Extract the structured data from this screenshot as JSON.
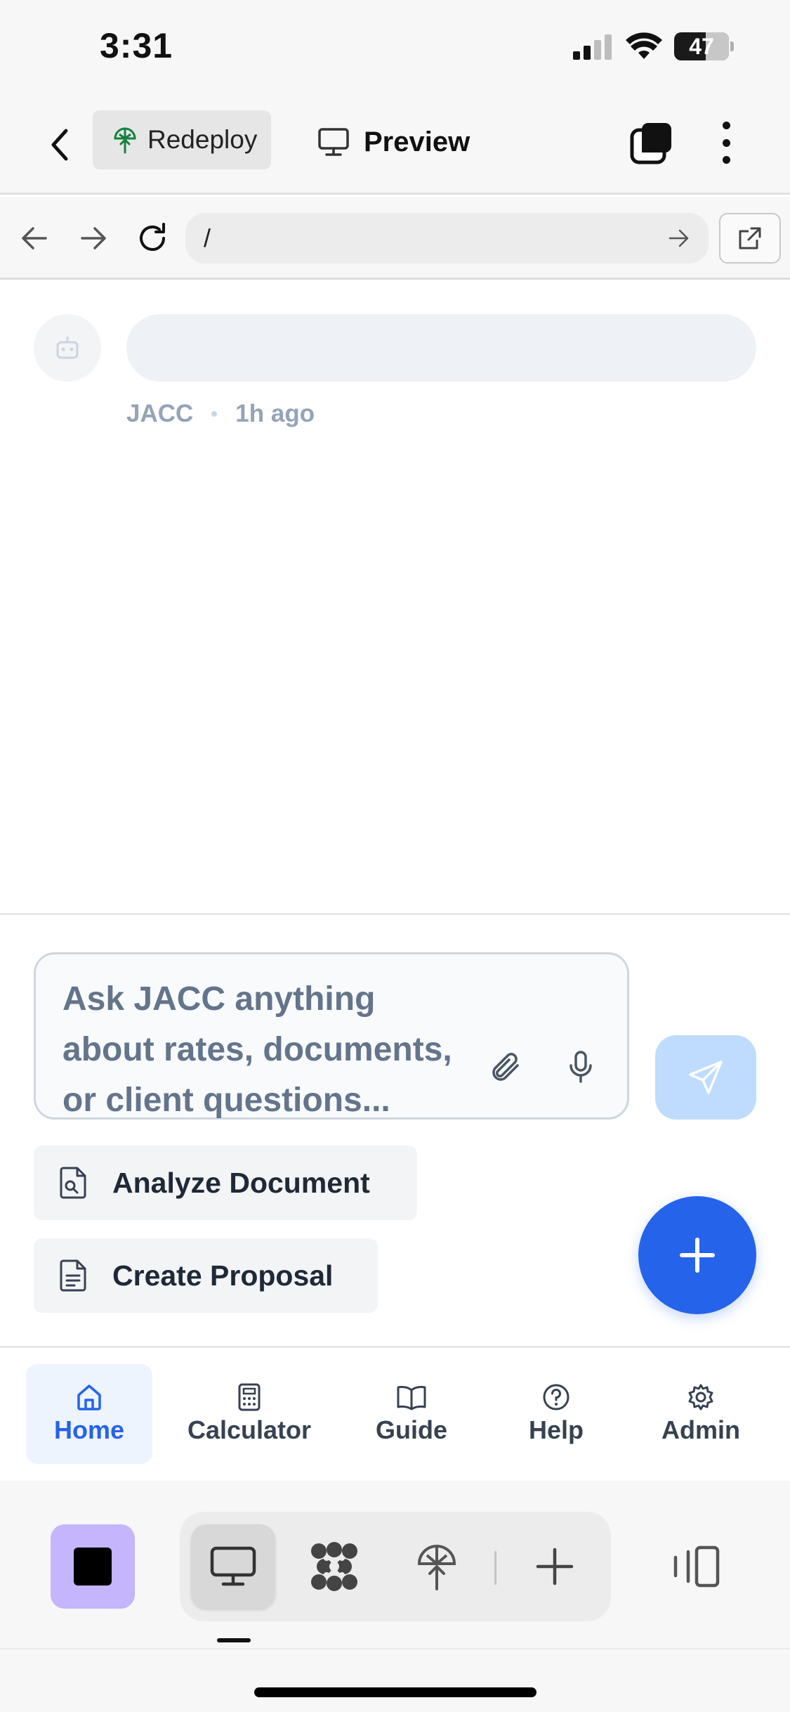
{
  "status_bar": {
    "time": "3:31",
    "battery": "47"
  },
  "top_bar": {
    "redeploy_label": "Redeploy",
    "preview_label": "Preview"
  },
  "browser": {
    "url": "/"
  },
  "chat": {
    "sender": "JACC",
    "timestamp": "1h ago"
  },
  "composer": {
    "placeholder": "Ask JACC anything about rates, documents, or client questions...",
    "actions": [
      {
        "label": "Analyze Document",
        "icon": "file-search-icon"
      },
      {
        "label": "Create Proposal",
        "icon": "file-text-icon"
      }
    ]
  },
  "bottom_nav": {
    "items": [
      {
        "label": "Home",
        "icon": "home-icon",
        "active": true
      },
      {
        "label": "Calculator",
        "icon": "calculator-icon"
      },
      {
        "label": "Guide",
        "icon": "book-icon"
      },
      {
        "label": "Help",
        "icon": "help-circle-icon"
      },
      {
        "label": "Admin",
        "icon": "gear-icon"
      }
    ]
  },
  "dock": {
    "items": [
      "stop-icon",
      "desktop-icon",
      "workspace-icon",
      "deploy-icon",
      "plus-icon",
      "panel-icon"
    ]
  },
  "colors": {
    "accent": "#2563eb",
    "send_disabled": "#bfdbfe",
    "stop_button": "#c4b5fd",
    "muted_text": "#64748b"
  }
}
